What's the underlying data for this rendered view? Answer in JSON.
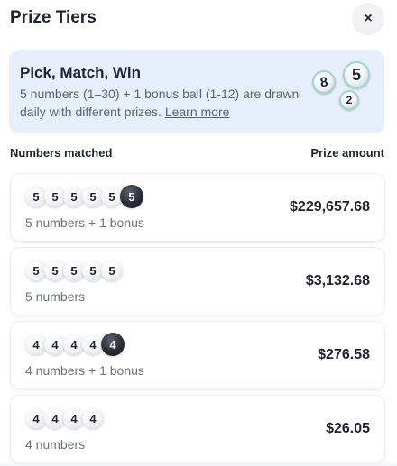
{
  "header": {
    "title": "Prize Tiers",
    "close_icon": "×"
  },
  "banner": {
    "title": "Pick, Match, Win",
    "description": "5 numbers (1–30) + 1 bonus ball (1-12) are drawn daily with different prizes.",
    "link_label": "Learn more",
    "balls": [
      "8",
      "5",
      "2"
    ]
  },
  "columns": {
    "left": "Numbers matched",
    "right": "Prize amount"
  },
  "tiers": [
    {
      "balls": [
        "5",
        "5",
        "5",
        "5",
        "5"
      ],
      "bonus": "5",
      "label": "5 numbers + 1 bonus",
      "amount": "$229,657.68"
    },
    {
      "balls": [
        "5",
        "5",
        "5",
        "5",
        "5"
      ],
      "bonus": null,
      "label": "5 numbers",
      "amount": "$3,132.68"
    },
    {
      "balls": [
        "4",
        "4",
        "4",
        "4"
      ],
      "bonus": "4",
      "label": "4 numbers + 1 bonus",
      "amount": "$276.58"
    },
    {
      "balls": [
        "4",
        "4",
        "4",
        "4"
      ],
      "bonus": null,
      "label": "4 numbers",
      "amount": "$26.05"
    }
  ]
}
